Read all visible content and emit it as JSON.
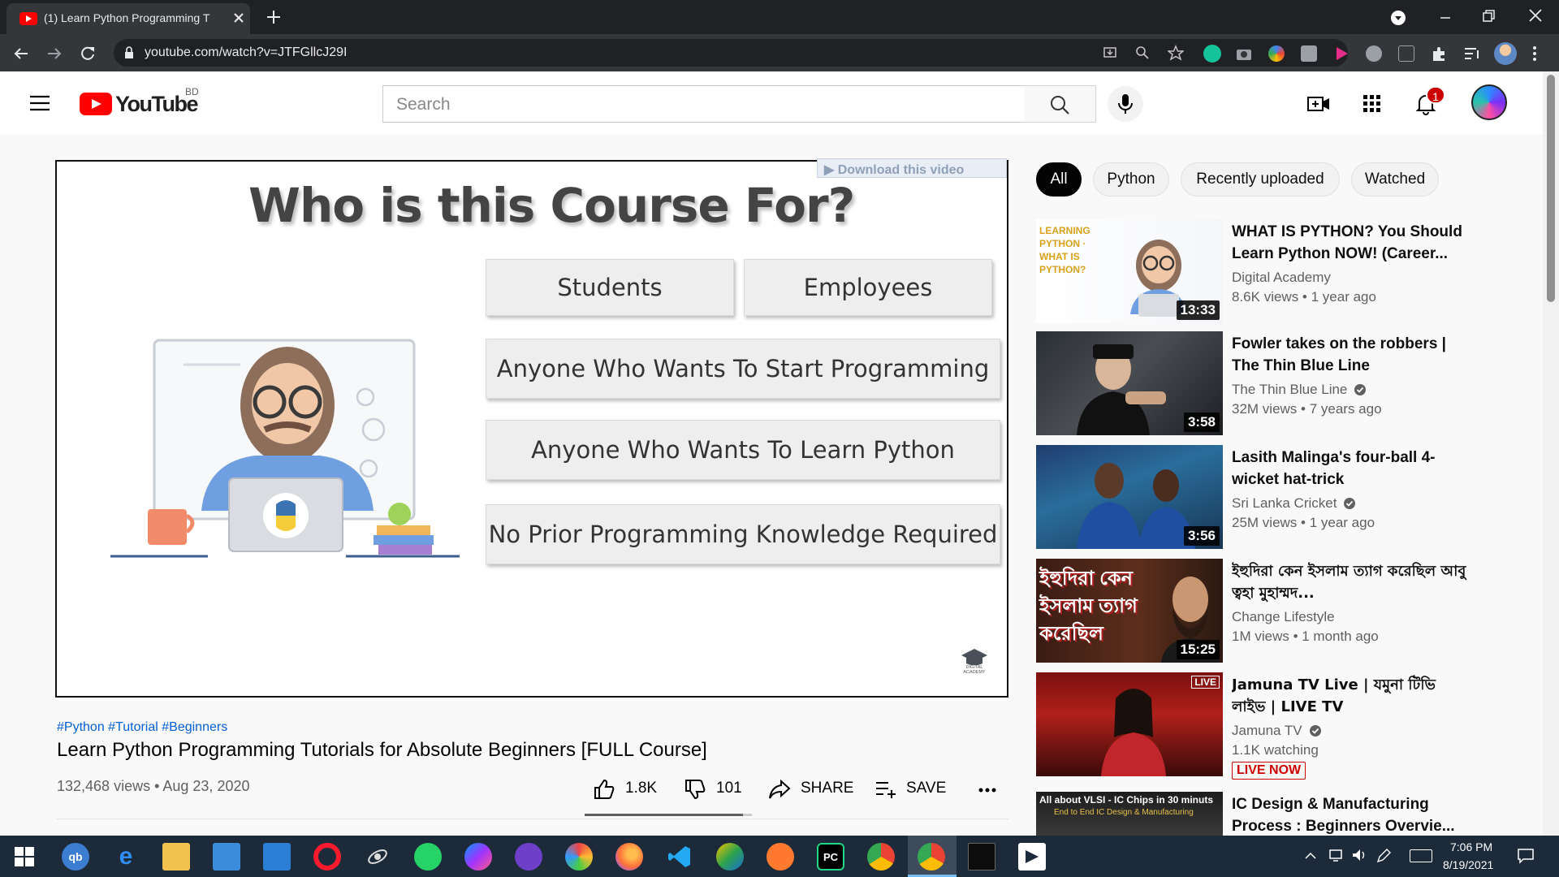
{
  "browser": {
    "tab_title": "(1) Learn Python Programming T",
    "url": "youtube.com/watch?v=JTFGllcJ29I"
  },
  "header": {
    "logo_text": "YouTube",
    "country": "BD",
    "search_placeholder": "Search",
    "notification_count": "1"
  },
  "player": {
    "download_label": "▶ Download this video",
    "slide_title": "Who is this Course For?",
    "boxes": [
      "Students",
      "Employees",
      "Anyone Who Wants To Start Programming",
      "Anyone Who Wants To Learn Python",
      "No Prior Programming Knowledge Required"
    ],
    "watermark": "DIGITAL ACADEMY"
  },
  "video": {
    "hashtags": "#Python #Tutorial #Beginners",
    "title": "Learn Python Programming Tutorials for Absolute Beginners [FULL Course]",
    "views_date": "132,468 views • Aug 23, 2020",
    "likes": "1.8K",
    "dislikes": "101",
    "share_label": "SHARE",
    "save_label": "SAVE",
    "like_ratio": 0.947
  },
  "chips": [
    "All",
    "Python",
    "Recently uploaded",
    "Watched"
  ],
  "recommendations": [
    {
      "title": "WHAT IS PYTHON? You Should Learn Python NOW! (Career...",
      "channel": "Digital Academy",
      "meta": "8.6K views • 1 year ago",
      "duration": "13:33",
      "thumb_text": "LEARNING PYTHON · WHAT IS PYTHON?"
    },
    {
      "title": "Fowler takes on the robbers | The Thin Blue Line",
      "channel": "The Thin Blue Line",
      "meta": "32M views • 7 years ago",
      "duration": "3:58"
    },
    {
      "title": "Lasith Malinga's four-ball 4-wicket hat-trick",
      "channel": "Sri Lanka Cricket",
      "meta": "25M views • 1 year ago",
      "duration": "3:56"
    },
    {
      "title": "ইহুদিরা কেন ইসলাম ত্যাগ করেছিল আবু ত্বহা মুহাম্মদ...",
      "channel": "Change Lifestyle",
      "meta": "1M views • 1 month ago",
      "duration": "15:25",
      "thumb_text": "ইহুদিরা কেন ইসলাম ত্যাগ করেছিল"
    },
    {
      "title": "Jamuna TV Live | যমুনা টিভি লাইভ | LIVE TV",
      "channel": "Jamuna TV",
      "meta": "1.1K watching",
      "badge": "LIVE NOW",
      "live_tag": "LIVE"
    },
    {
      "title": "IC Design & Manufacturing Process : Beginners Overvie...",
      "thumb_text": "All about VLSI - IC Chips in 30 minuts",
      "thumb_subtext": "End to End IC Design & Manufacturing"
    }
  ],
  "taskbar": {
    "time": "7:06 PM",
    "date": "8/19/2021"
  },
  "colors": {
    "youtube_red": "#ff0000",
    "chrome_dark": "#202124",
    "chrome_toolbar": "#35363a",
    "taskbar": "#1c2a3a",
    "link_blue": "#065fd4"
  }
}
